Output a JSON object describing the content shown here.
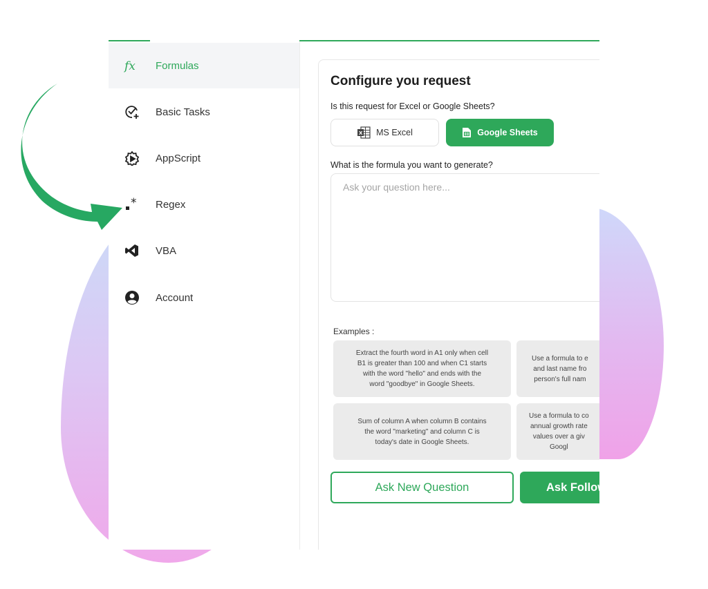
{
  "colors": {
    "accent": "#2ea85a",
    "sidebar_active_bg": "#f4f5f7",
    "card_bg": "#ebebeb"
  },
  "sidebar": {
    "items": [
      {
        "label": "Formulas",
        "icon": "fx-icon",
        "active": true
      },
      {
        "label": "Basic Tasks",
        "icon": "check-add-icon",
        "active": false
      },
      {
        "label": "AppScript",
        "icon": "gear-play-icon",
        "active": false
      },
      {
        "label": "Regex",
        "icon": "regex-icon",
        "active": false
      },
      {
        "label": "VBA",
        "icon": "vscode-icon",
        "active": false
      },
      {
        "label": "Account",
        "icon": "user-circle-icon",
        "active": false
      }
    ]
  },
  "panel": {
    "title": "Configure you request",
    "tool_question": "Is this request for Excel or Google Sheets?",
    "tools": {
      "excel_label": "MS Excel",
      "sheets_label": "Google Sheets",
      "selected": "Google Sheets"
    },
    "formula_question": "What is the formula you want to generate?",
    "textarea": {
      "placeholder": "Ask your question here...",
      "value": ""
    },
    "examples_label": "Examples :",
    "examples": [
      {
        "lines": [
          "Extract the fourth word in A1 only when cell",
          "B1 is greater than 100 and when C1 starts",
          "with the word \"hello\" and ends with the",
          "word \"goodbye\" in Google Sheets."
        ]
      },
      {
        "lines": [
          "Use a formula to e",
          "and last name fro",
          "person's full nam"
        ]
      },
      {
        "lines": [
          "Sum of column A when column B contains",
          "the word \"marketing\" and column C is",
          "today's date in Google Sheets."
        ]
      },
      {
        "lines": [
          "Use a formula to co",
          "annual growth rate",
          "values over a giv",
          "Googl"
        ]
      }
    ],
    "buttons": {
      "ask_new": "Ask New Question",
      "ask_follow": "Ask Follow"
    }
  }
}
